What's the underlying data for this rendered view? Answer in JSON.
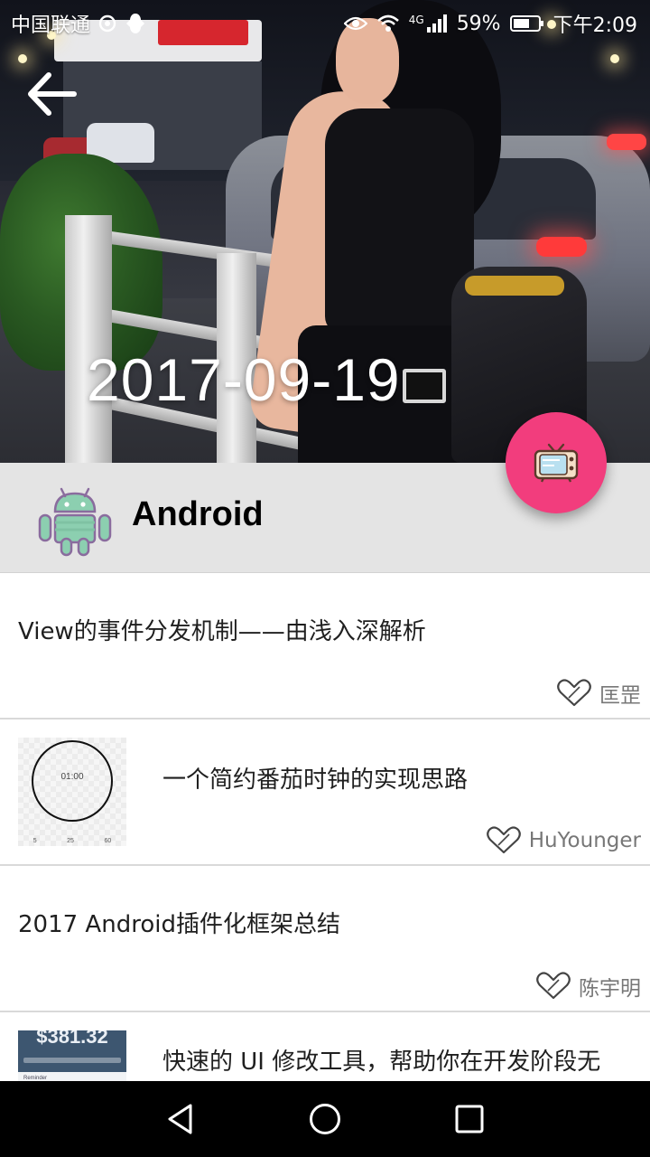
{
  "status_bar": {
    "carrier": "中国联通",
    "network": "4G",
    "battery": "59%",
    "time": "下午2:09"
  },
  "hero": {
    "date": "2017-09-19"
  },
  "category": {
    "title": "Android",
    "icon": "android-robot-icon"
  },
  "fab": {
    "icon": "tv-icon",
    "color": "#f23d7d"
  },
  "articles": [
    {
      "title": "View的事件分发机制——由浅入深解析",
      "author": "匡罡",
      "has_thumbnail": false
    },
    {
      "title": "一个简约番茄时钟的实现思路",
      "author": "HuYounger",
      "has_thumbnail": true,
      "thumbnail": {
        "time": "01:00",
        "ticks": [
          "5",
          "25",
          "60"
        ]
      }
    },
    {
      "title": "2017 Android插件化框架总结",
      "author": "陈宇明",
      "has_thumbnail": false
    },
    {
      "title": "快速的 UI 修改工具，帮助你在开发阶段无",
      "author": "",
      "has_thumbnail": true,
      "thumbnail": {
        "amount": "$381.32",
        "caption": "Reminder"
      }
    }
  ],
  "colors": {
    "header_bg": "#e4e4e4",
    "accent": "#f23d7d",
    "android_green": "#8ccfb0",
    "android_outline": "#8a6c9e"
  },
  "nav": {
    "back": "back-triangle-icon",
    "home": "home-circle-icon",
    "recents": "recents-square-icon"
  }
}
